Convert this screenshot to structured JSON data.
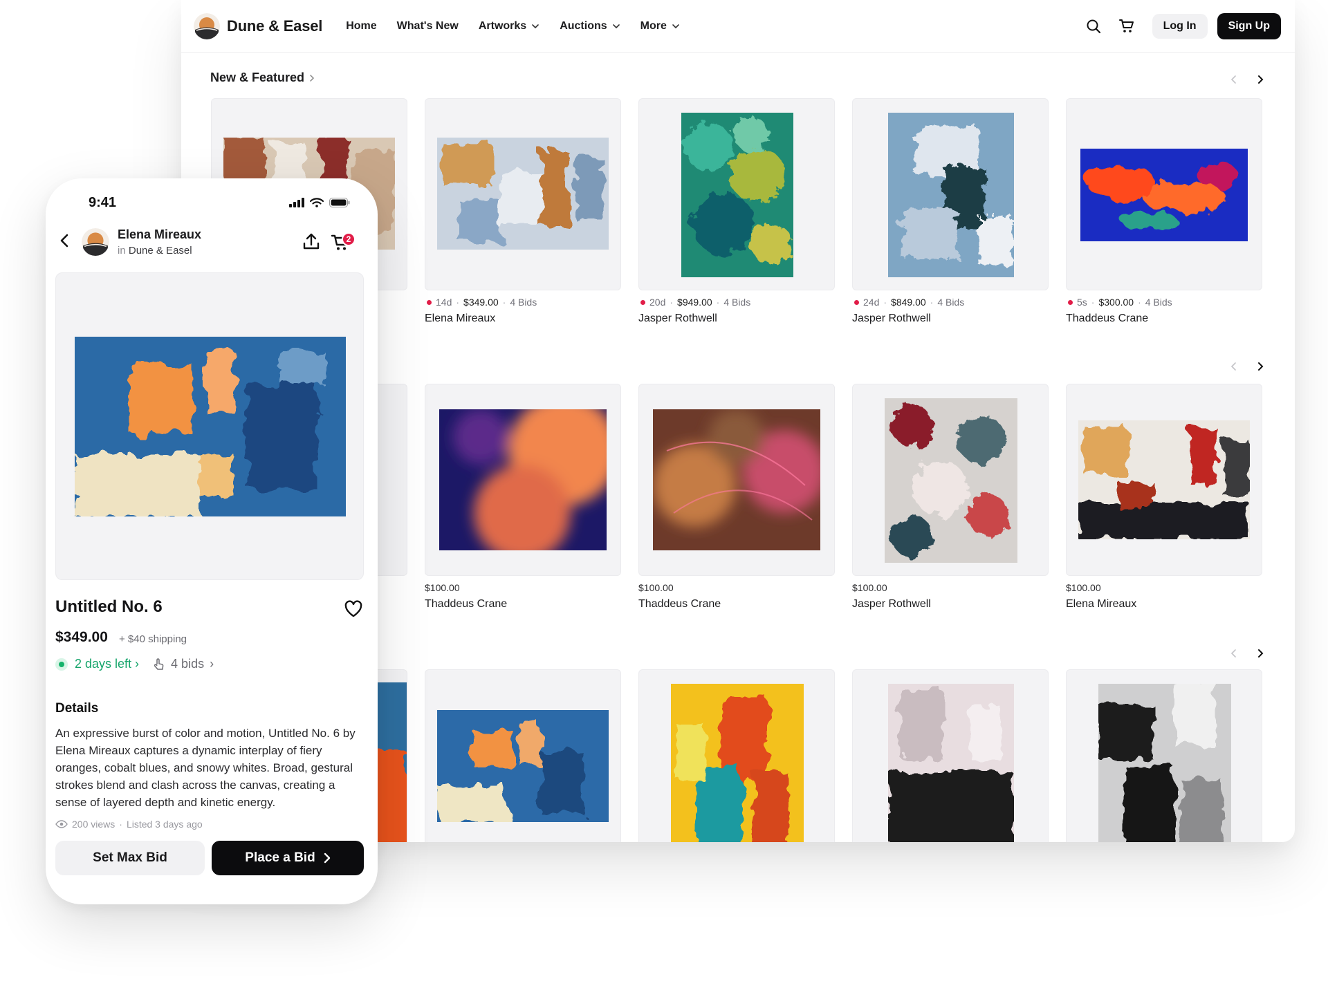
{
  "brand": {
    "name": "Dune & Easel"
  },
  "nav": {
    "links": [
      "Home",
      "What's New",
      "Artworks",
      "Auctions",
      "More"
    ],
    "login": "Log In",
    "signup": "Sign Up"
  },
  "section": {
    "title": "New & Featured"
  },
  "rows": [
    [
      {
        "time": "",
        "price": "",
        "bids": "",
        "artist": ""
      },
      {
        "time": "14d",
        "price": "$349.00",
        "bids": "4 Bids",
        "artist": "Elena Mireaux"
      },
      {
        "time": "20d",
        "price": "$949.00",
        "bids": "4 Bids",
        "artist": "Jasper Rothwell"
      },
      {
        "time": "24d",
        "price": "$849.00",
        "bids": "4 Bids",
        "artist": "Jasper Rothwell"
      },
      {
        "time": "5s",
        "price": "$300.00",
        "bids": "4 Bids",
        "artist": "Thaddeus Crane"
      }
    ],
    [
      {
        "price": "",
        "artist": ""
      },
      {
        "price": "$100.00",
        "artist": "Thaddeus Crane"
      },
      {
        "price": "$100.00",
        "artist": "Thaddeus Crane"
      },
      {
        "price": "$100.00",
        "artist": "Jasper Rothwell"
      },
      {
        "price": "$100.00",
        "artist": "Elena Mireaux"
      }
    ]
  ],
  "phone": {
    "time": "9:41",
    "seller": {
      "name": "Elena Mireaux",
      "in": "in",
      "shop": "Dune & Easel"
    },
    "cart_count": "2",
    "title": "Untitled No. 6",
    "price": "$349.00",
    "shipping": "+ $40 shipping",
    "days_left": "2 days left",
    "bids": "4 bids",
    "details_heading": "Details",
    "details": "An expressive burst of color and motion, Untitled No. 6 by Elena Mireaux captures a dynamic interplay of fiery oranges, cobalt blues, and snowy whites. Broad, gestural strokes blend and clash across the canvas, creating a sense of layered depth and kinetic energy.",
    "views": "200 views",
    "listed": "Listed 3 days ago",
    "set_max_bid": "Set Max Bid",
    "place_bid": "Place a Bid"
  },
  "colors": {
    "accent_dark": "#0c0c0e",
    "live_green": "#14a46a",
    "badge_red": "#e11d48"
  }
}
